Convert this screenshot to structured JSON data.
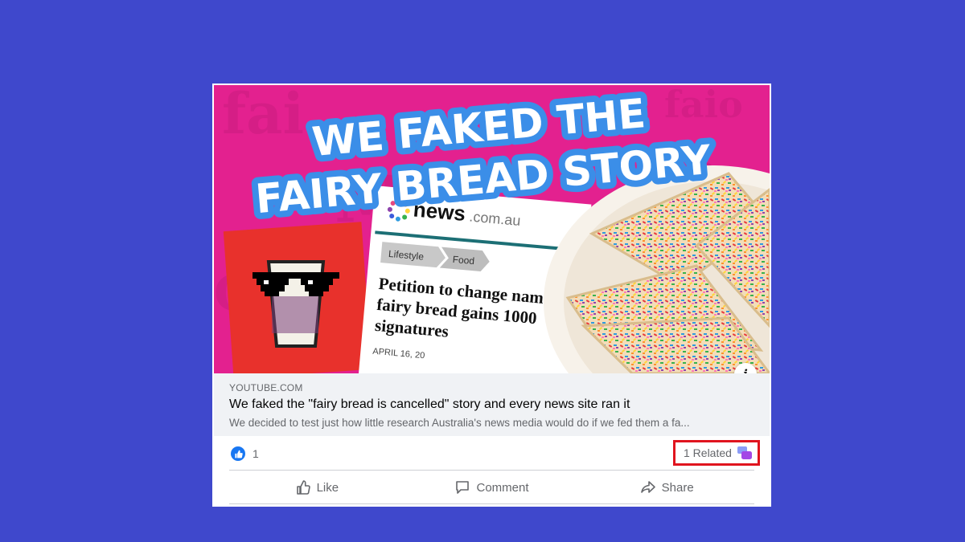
{
  "post": {
    "thumbnail": {
      "headline_line1": "WE FAKED THE",
      "headline_line2": "FAIRY BREAD STORY",
      "news_logo": "news",
      "news_logo_suffix": ".com.au",
      "breadcrumb_1": "Lifestyle",
      "breadcrumb_2": "Food",
      "article_line1": "Petition to change name o",
      "article_line2": "fairy bread gains 1000",
      "article_line3": "signatures",
      "article_date": "APRIL 16, 20",
      "info_label": "i"
    },
    "link": {
      "domain": "YOUTUBE.COM",
      "title": "We faked the \"fairy bread is cancelled\" story and every news site ran it",
      "description": "We decided to test just how little research Australia's news media would do if we fed them a fa..."
    },
    "stats": {
      "like_count": "1",
      "related_label": "1 Related"
    },
    "actions": {
      "like": "Like",
      "comment": "Comment",
      "share": "Share"
    }
  },
  "colors": {
    "background": "#3f48cc",
    "thumbnail_pink": "#e3218f",
    "headline_blue": "#3b8ee8",
    "highlight_red": "#e0141e",
    "like_blue": "#1877f2"
  }
}
